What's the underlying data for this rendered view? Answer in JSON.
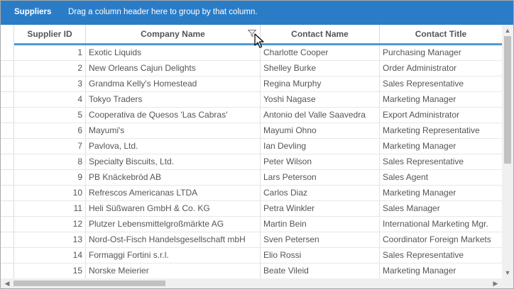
{
  "group_panel": {
    "title": "Suppliers",
    "hint": "Drag a column header here to group by that column."
  },
  "columns": [
    {
      "key": "id",
      "label": "Supplier ID"
    },
    {
      "key": "company",
      "label": "Company Name"
    },
    {
      "key": "contact",
      "label": "Contact Name"
    },
    {
      "key": "title",
      "label": "Contact Title"
    }
  ],
  "rows": [
    {
      "id": "1",
      "company": "Exotic Liquids",
      "contact": "Charlotte Cooper",
      "title": "Purchasing Manager"
    },
    {
      "id": "2",
      "company": "New Orleans Cajun Delights",
      "contact": "Shelley Burke",
      "title": "Order Administrator"
    },
    {
      "id": "3",
      "company": "Grandma Kelly's Homestead",
      "contact": "Regina Murphy",
      "title": "Sales Representative"
    },
    {
      "id": "4",
      "company": "Tokyo Traders",
      "contact": "Yoshi Nagase",
      "title": "Marketing Manager"
    },
    {
      "id": "5",
      "company": "Cooperativa de Quesos 'Las Cabras'",
      "contact": "Antonio del Valle Saavedra",
      "title": "Export Administrator"
    },
    {
      "id": "6",
      "company": "Mayumi's",
      "contact": "Mayumi Ohno",
      "title": "Marketing Representative"
    },
    {
      "id": "7",
      "company": "Pavlova, Ltd.",
      "contact": "Ian Devling",
      "title": "Marketing Manager"
    },
    {
      "id": "8",
      "company": "Specialty Biscuits, Ltd.",
      "contact": "Peter Wilson",
      "title": "Sales Representative"
    },
    {
      "id": "9",
      "company": "PB Knäckebröd AB",
      "contact": "Lars Peterson",
      "title": "Sales Agent"
    },
    {
      "id": "10",
      "company": "Refrescos Americanas LTDA",
      "contact": "Carlos Diaz",
      "title": "Marketing Manager"
    },
    {
      "id": "11",
      "company": "Heli Süßwaren GmbH & Co. KG",
      "contact": "Petra Winkler",
      "title": "Sales Manager"
    },
    {
      "id": "12",
      "company": "Plutzer Lebensmittelgroßmärkte AG",
      "contact": "Martin Bein",
      "title": "International Marketing Mgr."
    },
    {
      "id": "13",
      "company": "Nord-Ost-Fisch Handelsgesellschaft mbH",
      "contact": "Sven Petersen",
      "title": "Coordinator Foreign Markets"
    },
    {
      "id": "14",
      "company": "Formaggi Fortini s.r.l.",
      "contact": "Elio Rossi",
      "title": "Sales Representative"
    },
    {
      "id": "15",
      "company": "Norske Meierier",
      "contact": "Beate Vileid",
      "title": "Marketing Manager"
    }
  ],
  "colors": {
    "group_panel_bg": "#2b7cc6",
    "header_accent": "#4d9bd6"
  },
  "icons": {
    "filter": "filter-funnel-icon",
    "cursor": "mouse-pointer-icon"
  }
}
